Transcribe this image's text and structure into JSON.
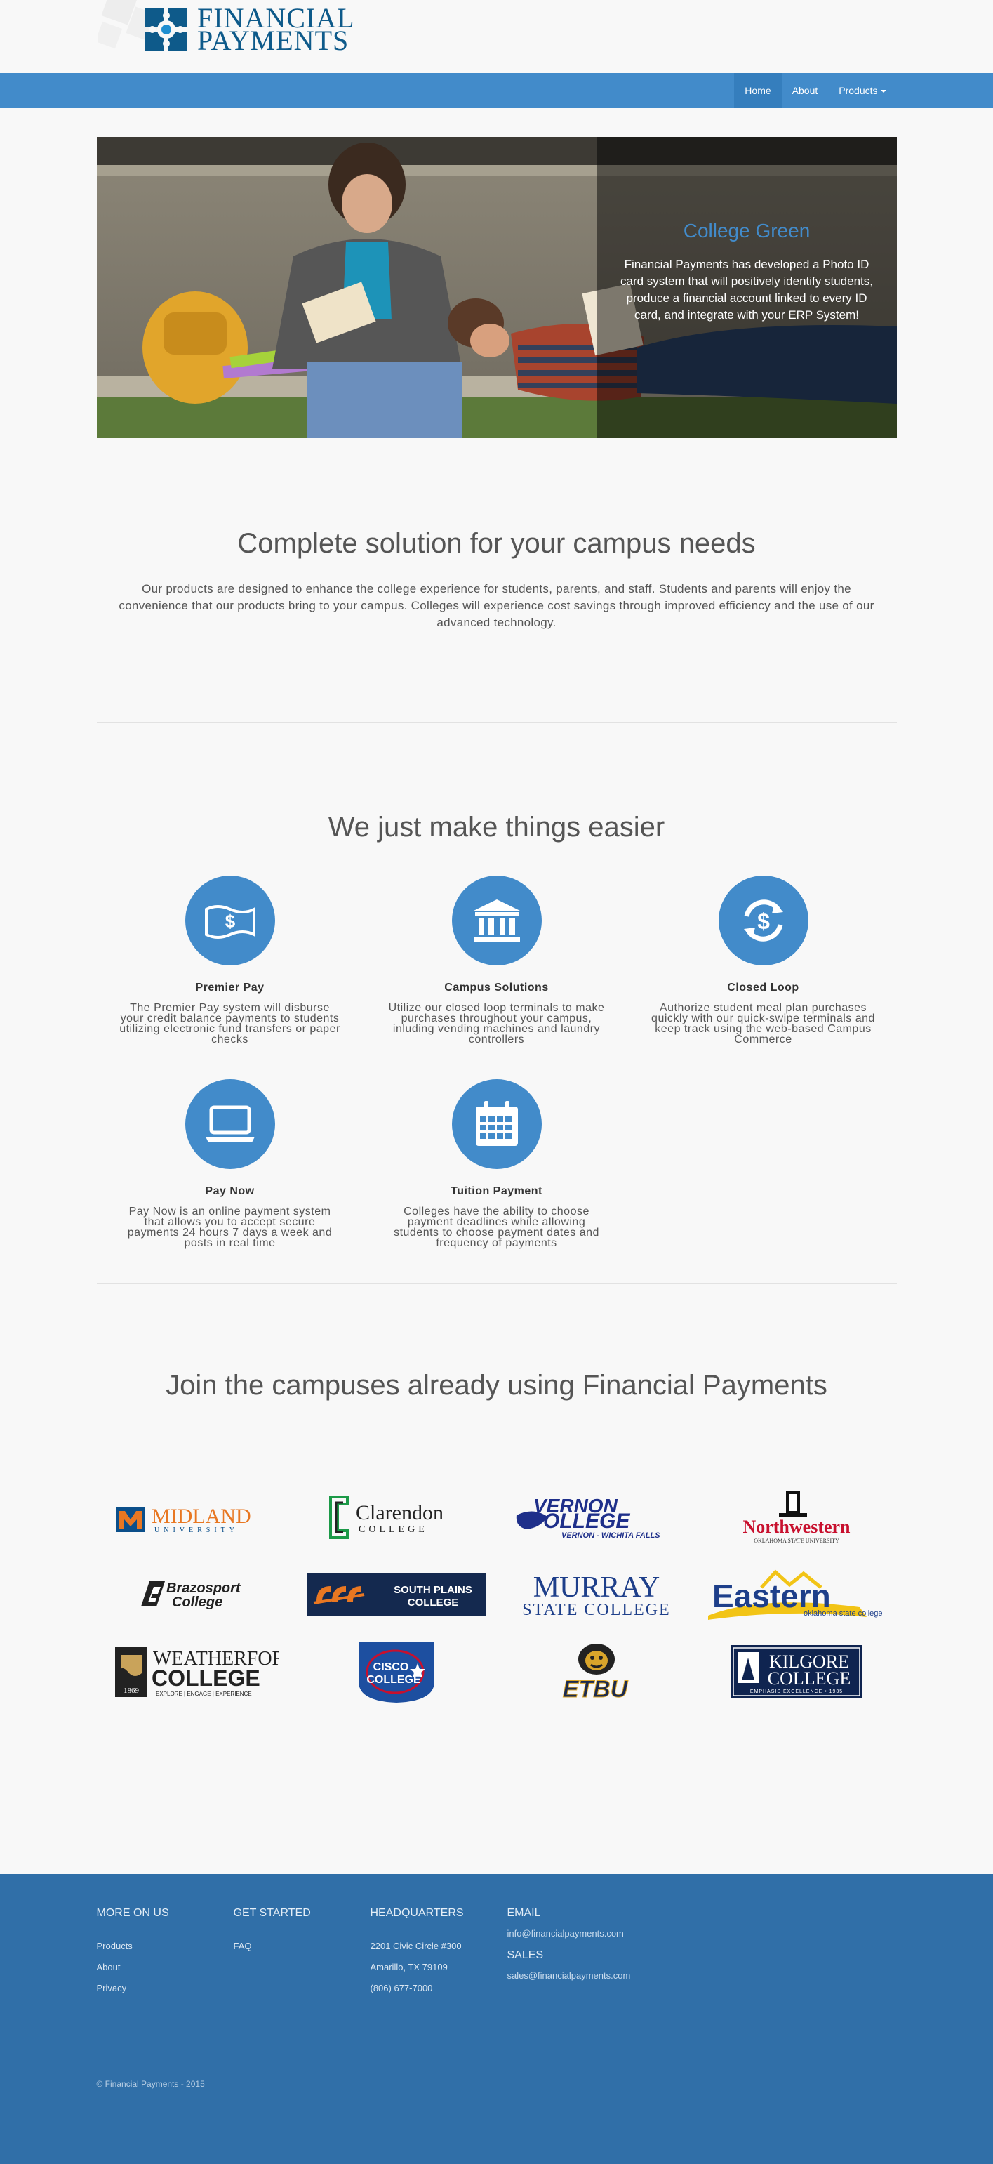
{
  "brand": {
    "line1": "FINANCIAL",
    "line2": "PAYMENTS",
    "color": "#0e5a8a"
  },
  "nav": {
    "items": [
      {
        "label": "Home",
        "active": true
      },
      {
        "label": "About"
      },
      {
        "label": "Products"
      }
    ],
    "color": "#428bca"
  },
  "hero": {
    "title": "College Green",
    "text": "Financial Payments has developed a Photo ID card system that will positively identify students, produce a financial account linked to every ID card, and integrate with your ERP System!"
  },
  "intro": {
    "heading": "Complete solution for your campus needs",
    "text": "Our products are designed to enhance the college experience for students, parents, and staff. Students and parents will enjoy the convenience that our products bring to your campus. Colleges will experience cost savings through improved efficiency and the use of our advanced technology."
  },
  "features": {
    "heading": "We just make things easier",
    "items": [
      {
        "title": "Premier Pay",
        "text": "The Premier Pay system will disburse your credit balance payments to students utilizing electronic fund transfers or paper checks",
        "icon": "money-icon"
      },
      {
        "title": "Campus Solutions",
        "text": "Utilize our closed loop terminals to make purchases throughout your campus, inluding vending machines and laundry controllers",
        "icon": "institution-icon"
      },
      {
        "title": "Closed Loop",
        "text": "Authorize student meal plan purchases quickly with our quick-swipe terminals and keep track using the web-based Campus Commerce",
        "icon": "dollar-refresh-icon"
      },
      {
        "title": "Pay Now",
        "text": "Pay Now is an online payment system that allows you to accept secure payments 24 hours 7 days a week and posts in real time",
        "icon": "laptop-icon"
      },
      {
        "title": "Tuition Payment",
        "text": "Colleges have the ability to choose payment deadlines while allowing students to choose payment dates and frequency of payments",
        "icon": "calendar-icon"
      }
    ]
  },
  "campuses": {
    "heading": "Join the campuses already using Financial Payments",
    "logos": {
      "midland": "MIDLAND",
      "midland_sub": "UNIVERSITY",
      "clarendon": "Clarendon",
      "clarendon_sub": "COLLEGE",
      "vernon": "VERNON",
      "vernon_big": "OLLEGE",
      "vernon_sub": "VERNON - WICHITA FALLS",
      "northwestern": "Northwestern",
      "northwestern_sub": "OKLAHOMA STATE UNIVERSITY",
      "brazosport1": "Brazosport",
      "brazosport2": "College",
      "southplains1": "SOUTH PLAINS",
      "southplains2": "COLLEGE",
      "murray1": "MURRAY",
      "murray2": "STATE COLLEGE",
      "eastern": "Eastern",
      "eastern_sub": "oklahoma state college",
      "weatherford1": "WEATHERFORD",
      "weatherford2": "COLLEGE",
      "weatherford_year": "1869",
      "weatherford_sub": "EXPLORE | ENGAGE | EXPERIENCE",
      "cisco1": "CISCO",
      "cisco2": "COLLEGE",
      "etbu": "ETBU",
      "kilgore1": "KILGORE",
      "kilgore2": "COLLEGE",
      "kilgore_sub": "EMPHASIS EXCELLENCE • 1935"
    }
  },
  "footer": {
    "more": {
      "heading": "MORE ON US",
      "links": [
        "Products",
        "About",
        "Privacy"
      ]
    },
    "start": {
      "heading": "GET STARTED",
      "links": [
        "FAQ"
      ]
    },
    "hq": {
      "heading": "HEADQUARTERS",
      "lines": [
        "2201 Civic Circle #300",
        "Amarillo, TX 79109",
        "(806) 677-7000"
      ]
    },
    "email": {
      "heading": "EMAIL",
      "address": "info@financialpayments.com",
      "sales_heading": "SALES",
      "sales_address": "sales@financialpayments.com"
    },
    "copyright": "© Financial Payments - 2015"
  }
}
